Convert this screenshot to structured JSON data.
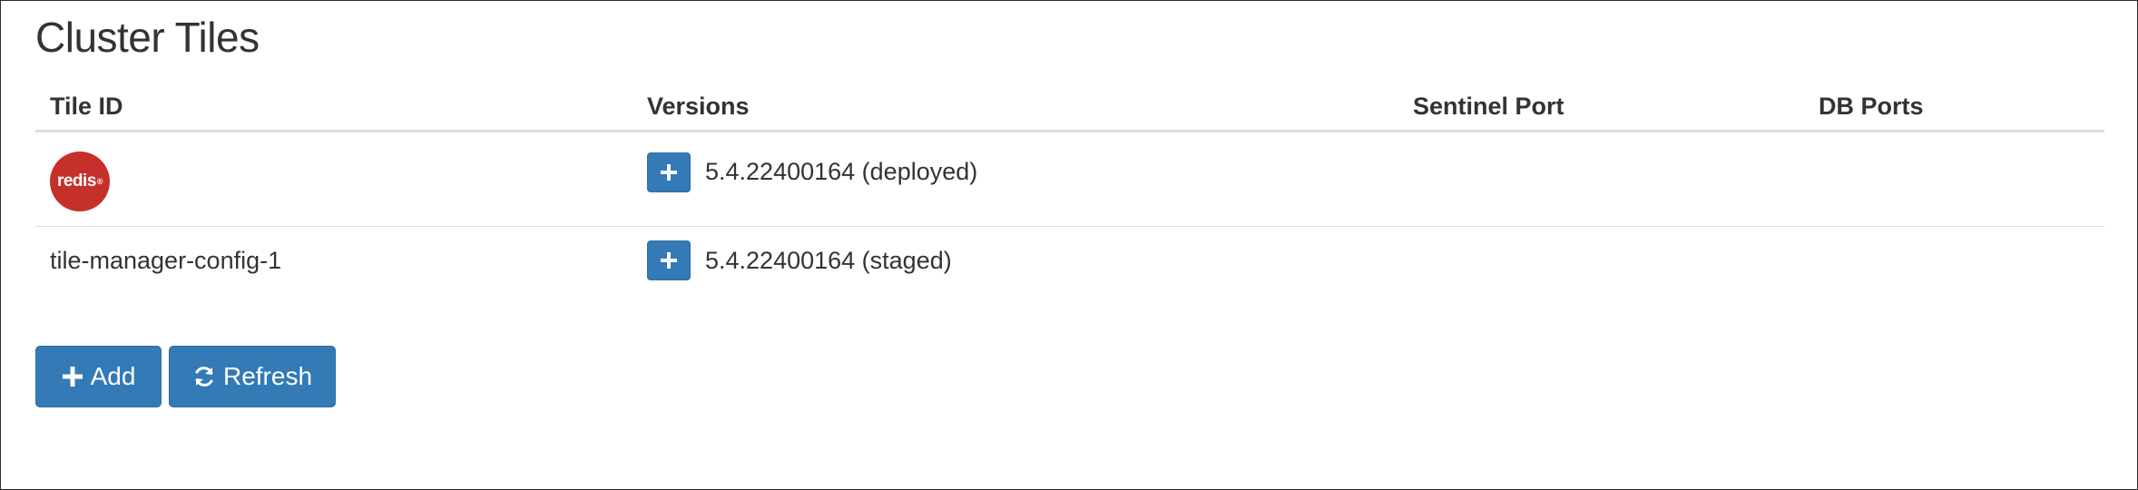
{
  "page": {
    "title": "Cluster Tiles"
  },
  "table": {
    "columns": [
      "Tile ID",
      "Versions",
      "Sentinel Port",
      "DB Ports"
    ],
    "rows": [
      {
        "tile_logo_text": "redis",
        "tile_logo_mark": "®",
        "version": "5.4.22400164 (deployed)",
        "sentinel_port": "",
        "db_ports": ""
      },
      {
        "tile_id": "tile-manager-config-1",
        "version": "5.4.22400164 (staged)",
        "sentinel_port": "",
        "db_ports": ""
      }
    ]
  },
  "actions": {
    "add_label": "Add",
    "refresh_label": "Refresh"
  },
  "icons": {
    "plus": "plus-icon",
    "refresh": "refresh-icon",
    "logo": "redis-logo"
  },
  "colors": {
    "primary": "#337ab7",
    "primary_border": "#2e6da4",
    "redis_red": "#c6302b",
    "text": "#333333",
    "divider": "#dddddd"
  }
}
